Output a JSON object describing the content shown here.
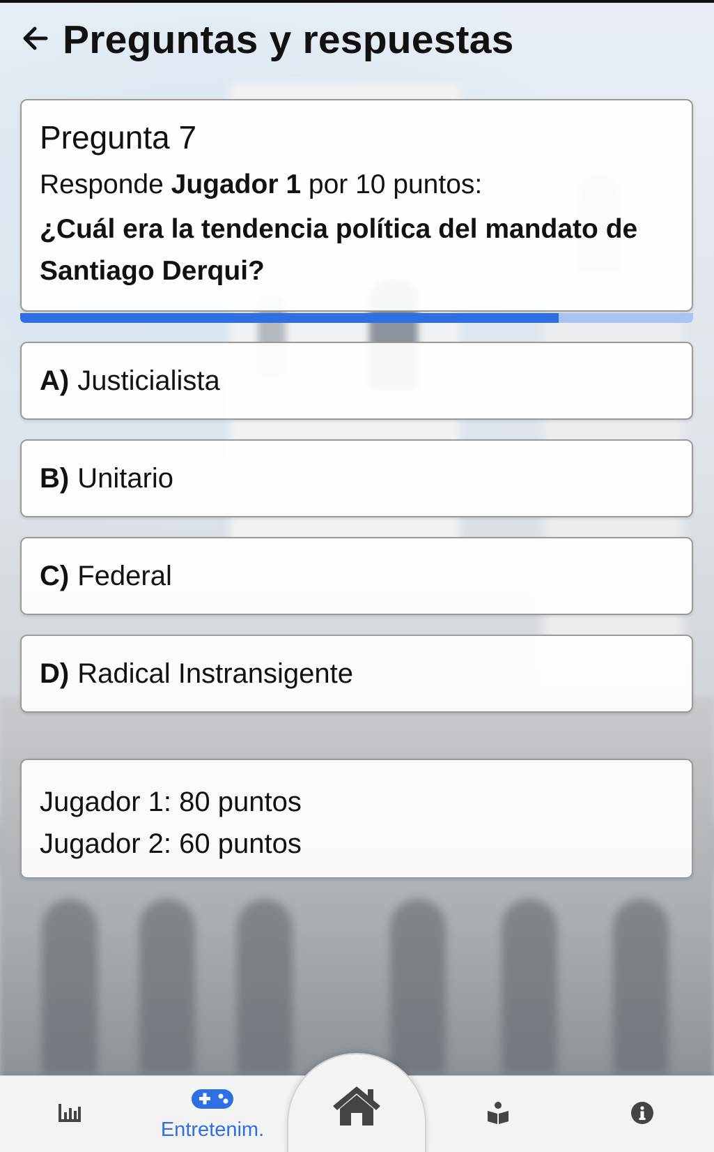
{
  "header": {
    "title": "Preguntas y respuestas",
    "back_icon": "arrow-left-icon"
  },
  "question": {
    "number_label": "Pregunta 7",
    "prompt_prefix": "Responde",
    "player": "Jugador 1",
    "prompt_suffix": "por 10 puntos:",
    "text": "¿Cuál era la tendencia política del mandato de Santiago Derqui?",
    "timer_progress": 0.8
  },
  "options": [
    {
      "letter": "A)",
      "text": "Justicialista"
    },
    {
      "letter": "B)",
      "text": "Unitario"
    },
    {
      "letter": "C)",
      "text": "Federal"
    },
    {
      "letter": "D)",
      "text": "Radical Instransigente"
    }
  ],
  "scores": [
    {
      "text": "Jugador 1: 80 puntos"
    },
    {
      "text": "Jugador 2: 60 puntos"
    }
  ],
  "bottom_nav": {
    "items": [
      {
        "icon": "bar-chart-icon",
        "label": ""
      },
      {
        "icon": "gamepad-icon",
        "label": "Entretenim.",
        "active": true
      },
      {
        "icon": "home-icon",
        "label": ""
      },
      {
        "icon": "book-reader-icon",
        "label": ""
      },
      {
        "icon": "info-icon",
        "label": ""
      }
    ],
    "active_color": "#2f6fe4"
  },
  "colors": {
    "progress_fill": "#2f6fe4",
    "progress_track": "#a9c3f3"
  }
}
